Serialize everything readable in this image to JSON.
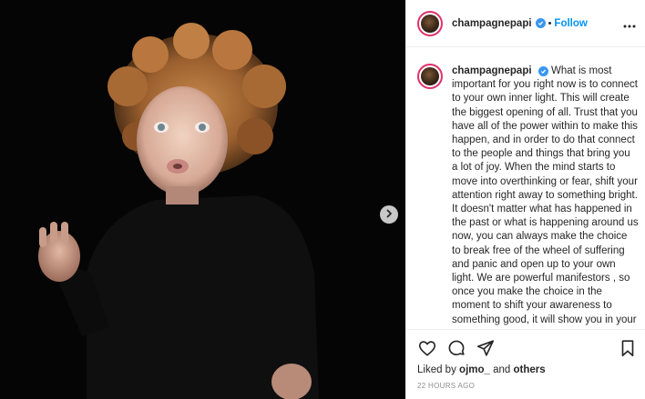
{
  "post": {
    "username": "champagnepapi",
    "separator": "•",
    "follow_label": "Follow",
    "caption": "What is most important for you right now is to connect to your own inner light. This will create the biggest opening of all. Trust that you have all of the power within to make this happen, and in order to do that connect to the people and things that bring you a lot of joy. When the mind starts to move into overthinking or fear, shift your attention right away to something bright. It doesn't matter what has happened in the past or what is happening around us now, you can always make the choice to break free of the wheel of suffering and panic and open up to your own light. We are powerful manifestors , so once you make the choice in the moment to shift your awareness to something good, it will show you in your reality.",
    "liked_prefix": "Liked by",
    "liked_user": "ojmo_",
    "liked_and": "and",
    "liked_others": "others",
    "timestamp": "22 HOURS AGO"
  },
  "icons": {
    "verified": "verified-badge-icon",
    "more": "more-options-icon",
    "next": "chevron-right-icon",
    "like": "heart-icon",
    "comment": "comment-icon",
    "share": "paper-plane-icon",
    "save": "bookmark-icon"
  },
  "colors": {
    "accent": "#0095f6",
    "verified": "#3897f0",
    "story_ring": "#e1306c",
    "photo_bg": "#050505",
    "muted": "#8e8e8e"
  }
}
